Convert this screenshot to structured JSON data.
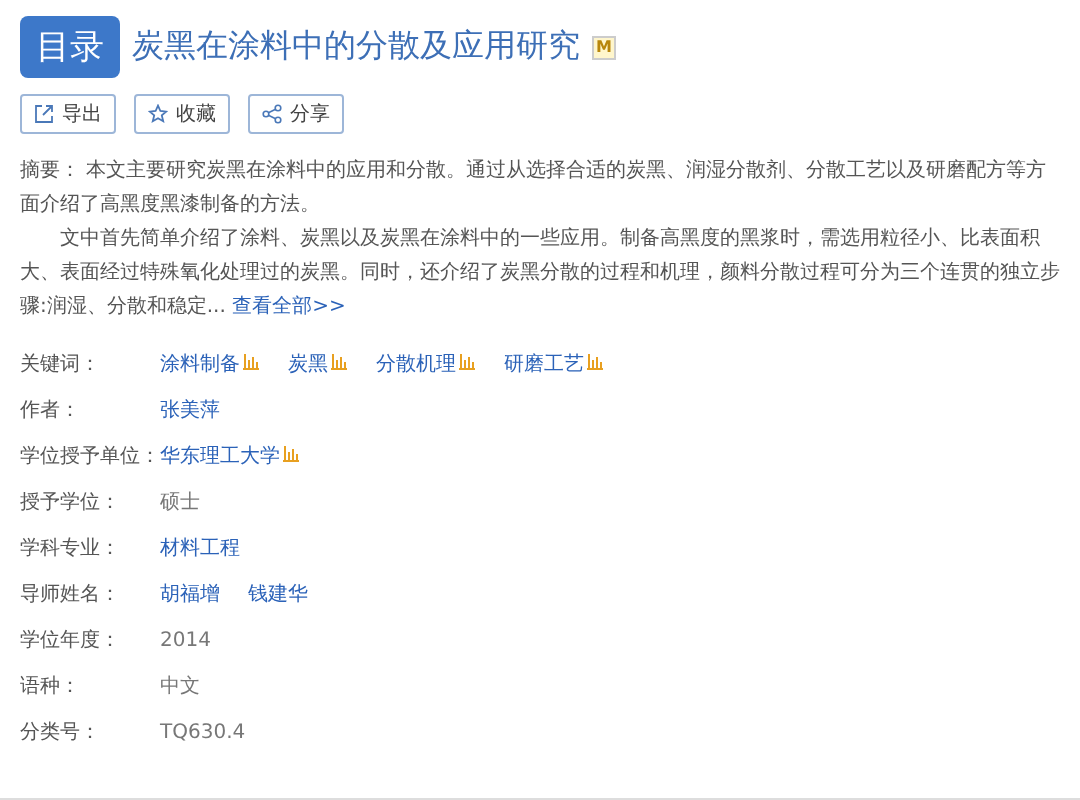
{
  "badge": "目录",
  "title": "炭黑在涂料中的分散及应用研究",
  "title_mark": "M",
  "actions": [
    {
      "kind": "export",
      "label": "导出"
    },
    {
      "kind": "favorite",
      "label": "收藏"
    },
    {
      "kind": "share",
      "label": "分享"
    }
  ],
  "abstract": {
    "label": "摘要：",
    "paragraphs": [
      "本文主要研究炭黑在涂料中的应用和分散。通过从选择合适的炭黑、润湿分散剂、分散工艺以及研磨配方等方面介绍了高黑度黑漆制备的方法。",
      "文中首先简单介绍了涂料、炭黑以及炭黑在涂料中的一些应用。制备高黑度的黑浆时，需选用粒径小、比表面积大、表面经过特殊氧化处理过的炭黑。同时，还介绍了炭黑分散的过程和机理，颜料分散过程可分为三个连贯的独立步骤:润湿、分散和稳定..."
    ],
    "more": "查看全部>>"
  },
  "fields": [
    {
      "label": "关键词：",
      "values": [
        {
          "text": "涂料制备",
          "link": true,
          "trend": true
        },
        {
          "text": "炭黑",
          "link": true,
          "trend": true
        },
        {
          "text": "分散机理",
          "link": true,
          "trend": true
        },
        {
          "text": "研磨工艺",
          "link": true,
          "trend": true
        }
      ]
    },
    {
      "label": "作者：",
      "values": [
        {
          "text": "张美萍",
          "link": true,
          "trend": false
        }
      ]
    },
    {
      "label": "学位授予单位：",
      "values": [
        {
          "text": "华东理工大学",
          "link": true,
          "trend": true
        }
      ]
    },
    {
      "label": "授予学位：",
      "values": [
        {
          "text": "硕士",
          "link": false,
          "trend": false
        }
      ]
    },
    {
      "label": "学科专业：",
      "values": [
        {
          "text": "材料工程",
          "link": true,
          "trend": false
        }
      ]
    },
    {
      "label": "导师姓名：",
      "values": [
        {
          "text": "胡福增",
          "link": true,
          "trend": false
        },
        {
          "text": "钱建华",
          "link": true,
          "trend": false
        }
      ]
    },
    {
      "label": "学位年度：",
      "values": [
        {
          "text": "2014",
          "link": false,
          "trend": false
        }
      ]
    },
    {
      "label": "语种：",
      "values": [
        {
          "text": "中文",
          "link": false,
          "trend": false
        }
      ]
    },
    {
      "label": "分类号：",
      "values": [
        {
          "text": "TQ630.4",
          "link": false,
          "trend": false
        }
      ]
    }
  ]
}
